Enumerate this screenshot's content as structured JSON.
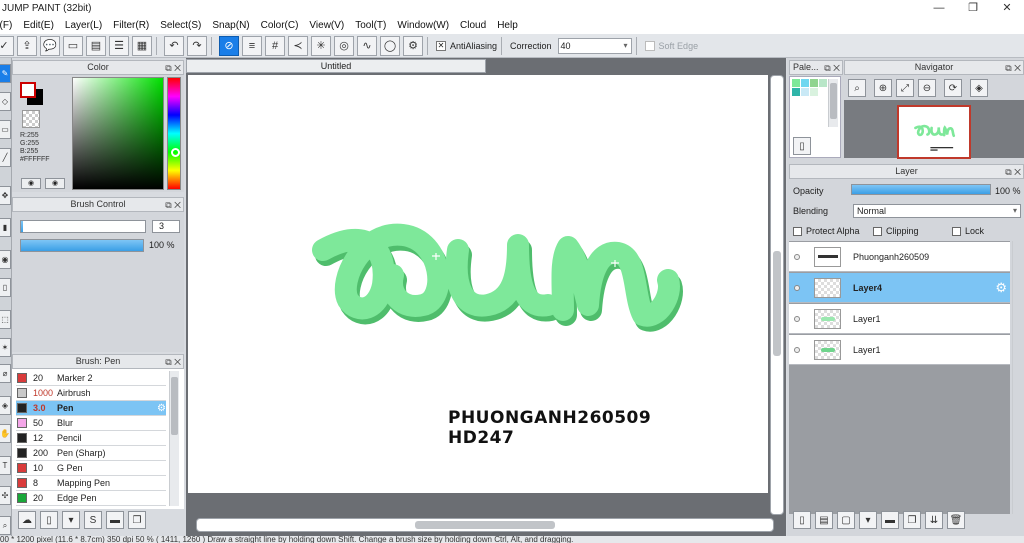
{
  "window": {
    "title": "JUMP PAINT (32bit)",
    "minimize": "—",
    "maximize": "❐",
    "close": "✕"
  },
  "menu": [
    "e(F)",
    "Edit(E)",
    "Layer(L)",
    "Filter(R)",
    "Select(S)",
    "Snap(N)",
    "Color(C)",
    "View(V)",
    "Tool(T)",
    "Window(W)",
    "Cloud",
    "Help"
  ],
  "toolbar": {
    "antialiasing_label": "AntiAliasing",
    "correction_label": "Correction",
    "correction_value": "40",
    "soft_edge_label": "Soft Edge",
    "antialias_check": "✕"
  },
  "panels": {
    "color_title": "Color",
    "brush_control_title": "Brush Control",
    "brush_list_title": "Brush: Pen",
    "palette_title": "Pale...",
    "navigator_title": "Navigator",
    "layer_title": "Layer",
    "panel_buttons": "⧉ ✕"
  },
  "color": {
    "r": "R:255",
    "g": "G:255",
    "b": "B:255",
    "hex": "#FFFFFF"
  },
  "brush_control": {
    "size_value": "3",
    "opacity_value": "100 %",
    "opacity_fraction": 1.0
  },
  "brushes": [
    {
      "size": "20",
      "name": "Marker 2",
      "color": "#d93b3b"
    },
    {
      "size": "1000",
      "name": "Airbrush",
      "color": "#c9c9c9"
    },
    {
      "size": "3.0",
      "name": "Pen",
      "color": "#222222",
      "selected": true
    },
    {
      "size": "50",
      "name": "Blur",
      "color": "#f4a6e8"
    },
    {
      "size": "12",
      "name": "Pencil",
      "color": "#222222"
    },
    {
      "size": "200",
      "name": "Pen (Sharp)",
      "color": "#222222"
    },
    {
      "size": "10",
      "name": "G Pen",
      "color": "#d93b3b"
    },
    {
      "size": "8",
      "name": "Mapping Pen",
      "color": "#d93b3b"
    },
    {
      "size": "20",
      "name": "Edge Pen",
      "color": "#1aa83a"
    }
  ],
  "canvas": {
    "tab_title": "Untitled",
    "art_text": "pun",
    "art_color": "#7ee89a",
    "art_shadow": "#4fbd6c",
    "caption_line1": "PHUONGANH260509",
    "caption_line2": "HD247"
  },
  "layer": {
    "opacity_label": "Opacity",
    "opacity_value": "100 %",
    "blending_label": "Blending",
    "blending_value": "Normal",
    "protect_alpha": "Protect Alpha",
    "clipping": "Clipping",
    "lock": "Lock",
    "layers": [
      {
        "name": "Phuonganh260509",
        "selected": false
      },
      {
        "name": "Layer4",
        "selected": true
      },
      {
        "name": "Layer1",
        "selected": false
      },
      {
        "name": "Layer1",
        "selected": false
      }
    ]
  },
  "status": "00 * 1200 pixel   (11.6 * 8.7cm)   350 dpi   50 %   ( 1411, 1260 )   Draw a straight line by holding down Shift. Change a brush size by holding down Ctrl, Alt, and dragging.",
  "accent": "#1a7ee8",
  "selection_color": "#7cc4f4"
}
